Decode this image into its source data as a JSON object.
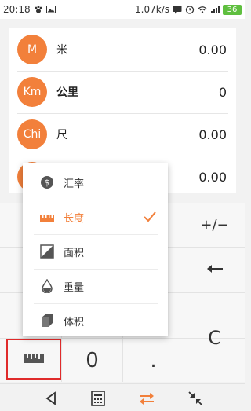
{
  "status_bar": {
    "time": "20:18",
    "speed": "1.07k/s",
    "battery": "36"
  },
  "units": [
    {
      "badge": "M",
      "name": "米",
      "value": "0.00",
      "bold": false
    },
    {
      "badge": "Km",
      "name": "公里",
      "value": "0",
      "bold": true
    },
    {
      "badge": "Chi",
      "name": "尺",
      "value": "0.00",
      "bold": false
    },
    {
      "badge": "",
      "name": "",
      "value": "0.00",
      "bold": false
    }
  ],
  "menu": {
    "items": [
      {
        "label": "汇率",
        "icon": "dollar-icon",
        "selected": false
      },
      {
        "label": "长度",
        "icon": "ruler-icon",
        "selected": true
      },
      {
        "label": "面积",
        "icon": "area-icon",
        "selected": false
      },
      {
        "label": "重量",
        "icon": "weight-drop-icon",
        "selected": false
      },
      {
        "label": "体积",
        "icon": "cube-icon",
        "selected": false
      }
    ]
  },
  "keypad": {
    "sign_key": "+/−",
    "zero_key": "0",
    "dot_key": ".",
    "clear_key": "C"
  },
  "colors": {
    "accent": "#f2803b",
    "highlight_border": "#e02b2b"
  }
}
